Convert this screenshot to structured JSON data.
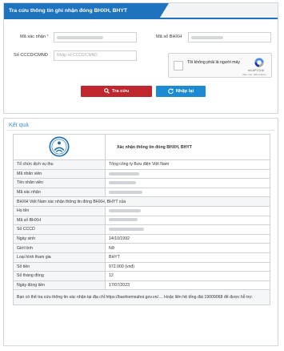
{
  "form": {
    "title": "Tra cứu thông tin ghi nhận đóng BHXH, BHYT",
    "ma_xac_nhan_label": "Mã xác nhận",
    "required_mark": "*",
    "ma_so_bhxh_label": "Mã số BHXH",
    "cccd_label": "Số CCCD/CMND",
    "cccd_placeholder": "Nhập số CCCD/CMND",
    "captcha_text": "Tôi không phải là người máy",
    "captcha_brand": "reCAPTCHA",
    "captcha_terms": "Bảo mật - Điều khoản",
    "search_button": "Tra cứu",
    "reset_button": "Nhập lại"
  },
  "result": {
    "title": "Kết quả",
    "header_title": "Xác nhận thông tin đóng BHXH, BHYT",
    "rows_a": [
      {
        "k": "Tổ chức dịch vụ thu",
        "v": "Tổng công ty Bưu điện Việt Nam"
      },
      {
        "k": "Mã nhân viên",
        "v": ""
      },
      {
        "k": "Tên nhân viên",
        "v": ""
      },
      {
        "k": "Mã xác nhận",
        "v": ""
      }
    ],
    "statement": "BHXH Việt Nam xác nhận thông tin đóng BHXH, BHYT của",
    "rows_b": [
      {
        "k": "Họ tên",
        "v": ""
      },
      {
        "k": "Mã số BHXH",
        "v": ""
      },
      {
        "k": "Số CCCD",
        "v": ""
      },
      {
        "k": "Ngày sinh",
        "v": "14/10/1992"
      },
      {
        "k": "Giới tính",
        "v": "Nữ"
      },
      {
        "k": "Loại hình tham gia",
        "v": "BHYT"
      },
      {
        "k": "Số tiền",
        "v": "972.000 (vnđ)"
      },
      {
        "k": "Số tháng đóng",
        "v": "12"
      },
      {
        "k": "Ngày đóng tiền",
        "v": "17/07/2023"
      }
    ],
    "note": "Bạn có thể tra cứu thông tin xác nhận tại địa chỉ https://baohiemxahoi.gov.vn/.... Hoặc liên hệ tổng đài 19009068 để được hỗ trợ."
  },
  "colors": {
    "primary": "#1e73be",
    "danger": "#c0262d",
    "info": "#1c8bd3",
    "result_title": "#3a8ed6"
  }
}
